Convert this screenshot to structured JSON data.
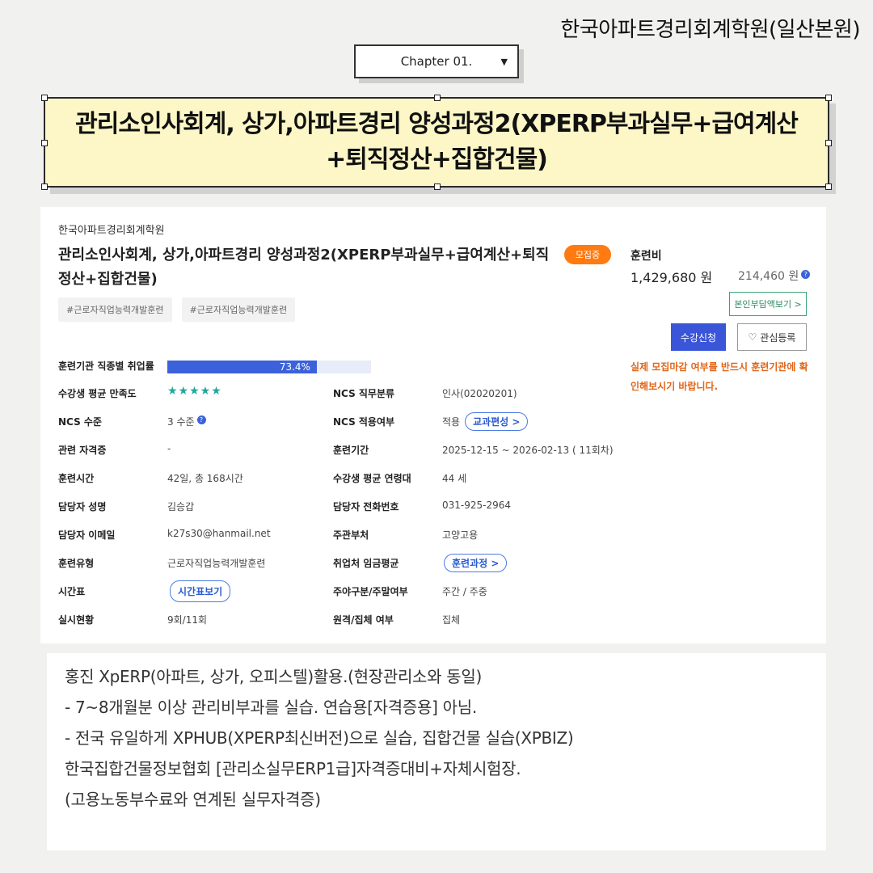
{
  "header": {
    "academy": "한국아파트경리회계학원(일산본원)"
  },
  "chapter_select": {
    "value": "Chapter 01."
  },
  "banner": {
    "title": "관리소인사회계, 상가,아파트경리 양성과정2(XPERP부과실무+급여계산+퇴직정산+집합건물)"
  },
  "course": {
    "institution": "한국아파트경리회계학원",
    "title": "관리소인사회계, 상가,아파트경리 양성과정2(XPERP부과실무+급여계산+퇴직정산+집합건물)",
    "badge": "모집중",
    "tags": [
      "#근로자직업능력개발훈련",
      "#근로자직업능력개발훈련"
    ],
    "employment_rate_label": "훈련기관 직종별 취업률",
    "employment_rate": 73.4,
    "employment_rate_text": "73.4%",
    "satisfaction_label": "수강생 평균 만족도",
    "satisfaction_stars": "★★★★★",
    "rows": [
      {
        "l1": "NCS 수준",
        "v1": "3 수준",
        "l2": "NCS 적용여부",
        "v2": "적용",
        "pill2": "교과편성 >"
      },
      {
        "l1": "관련 자격증",
        "v1": "-",
        "l2": "훈련기간",
        "v2": "2025-12-15 ~ 2026-02-13 ( 11회차)"
      },
      {
        "l1": "훈련시간",
        "v1": "42일, 총 168시간",
        "l2": "수강생 평균 연령대",
        "v2": "44 세"
      },
      {
        "l1": "담당자 성명",
        "v1": "김승갑",
        "l2": "담당자 전화번호",
        "v2": "031-925-2964"
      },
      {
        "l1": "담당자 이메일",
        "v1": "k27s30@hanmail.net",
        "l2": "주관부처",
        "v2": "고양고용"
      },
      {
        "l1": "훈련유형",
        "v1": "근로자직업능력개발훈련",
        "l2": "취업처 임금평균",
        "pill2": "훈련과정 >"
      },
      {
        "l1": "시간표",
        "pill1": "시간표보기",
        "l2": "주야구분/주말여부",
        "v2": "주간 / 주중"
      },
      {
        "l1": "실시현황",
        "v1": "9회/11회",
        "l2": "원격/집체 여부",
        "v2": "집체"
      }
    ],
    "ncs_class_label": "NCS 직무분류",
    "ncs_class_value": "인사(02020201)"
  },
  "fee": {
    "label": "훈련비",
    "total": "1,429,680 원",
    "self_pay": "214,460 원",
    "self_pay_button": "본인부담액보기 >",
    "apply_button": "수강신청",
    "favorite_button": "관심등록",
    "notice": "실제 모집마감 여부를 반드시 훈련기관에 확인해보시기 바랍니다."
  },
  "notes": [
    "홍진 XpERP(아파트, 상가, 오피스텔)활용.(현장관리소와 동일)",
    "- 7~8개월분 이상 관리비부과를 실습.  연습용[자격증용] 아님.",
    "- 전국 유일하게 XPHUB(XPERP최신버전)으로 실습, 집합건물 실습(XPBIZ)",
    "한국집합건물정보협회 [관리소실무ERP1급]자격증대비+자체시험장.",
    "(고용노동부수료와 연계된 실무자격증)"
  ],
  "colors": {
    "banner_bg": "#fdf7c7",
    "badge": "#ff7a10",
    "primary": "#3b55d8",
    "notice": "#e0661a",
    "stars": "#1fa89b"
  }
}
